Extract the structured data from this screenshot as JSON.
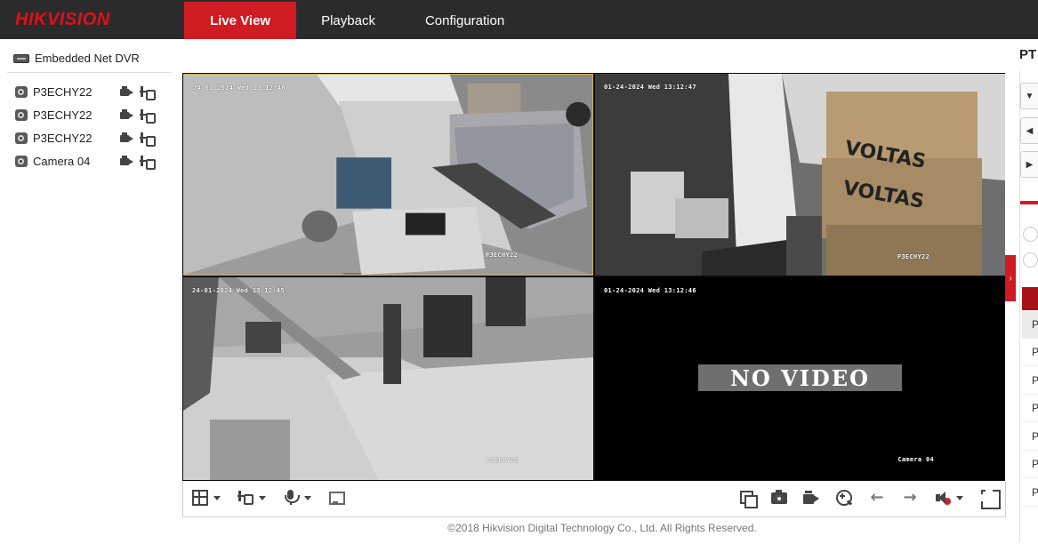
{
  "header": {
    "logo": "HIKVISION",
    "tabs": [
      {
        "label": "Live View",
        "active": true
      },
      {
        "label": "Playback",
        "active": false
      },
      {
        "label": "Configuration",
        "active": false
      }
    ],
    "accent_color": "#cf1b22",
    "bar_color": "#2b2b2b"
  },
  "sidebar": {
    "device_label": "Embedded Net DVR",
    "cameras": [
      {
        "label": "P3ECHY22",
        "icon": "camera-icon"
      },
      {
        "label": "P3ECHY22",
        "icon": "camera-icon"
      },
      {
        "label": "P3ECHY22",
        "icon": "camera-icon"
      },
      {
        "label": "Camera 04",
        "icon": "camera-icon"
      }
    ]
  },
  "video": {
    "panes": [
      {
        "timestamp": "24-01-2024 Wed 13:12:46",
        "name": "P3ECHY22",
        "selected": true
      },
      {
        "timestamp": "01-24-2024 Wed 13:12:47",
        "name": "P3ECHY22",
        "selected": false
      },
      {
        "timestamp": "24-01-2024 Wed 13:12:45",
        "name": "P3ECHY22",
        "selected": false
      },
      {
        "timestamp": "01-24-2024 Wed 13:12:46",
        "name": "Camera 04",
        "selected": false,
        "no_video_text": "NO VIDEO"
      }
    ]
  },
  "toolbar": {
    "left": [
      "layout-icon",
      "stream-icon",
      "microphone-icon",
      "ezoom-icon"
    ],
    "right": [
      "multi-window-icon",
      "snapshot-icon",
      "record-icon",
      "zoom-in-icon",
      "previous-arrow-icon",
      "next-arrow-icon",
      "volume-icon",
      "fullscreen-icon"
    ]
  },
  "footer": {
    "copyright": "©2018 Hikvision Digital Technology Co., Ltd. All Rights Reserved."
  },
  "ptz": {
    "title": "PT",
    "presets": [
      "P",
      "P",
      "P",
      "P",
      "P",
      "P",
      "P"
    ]
  }
}
